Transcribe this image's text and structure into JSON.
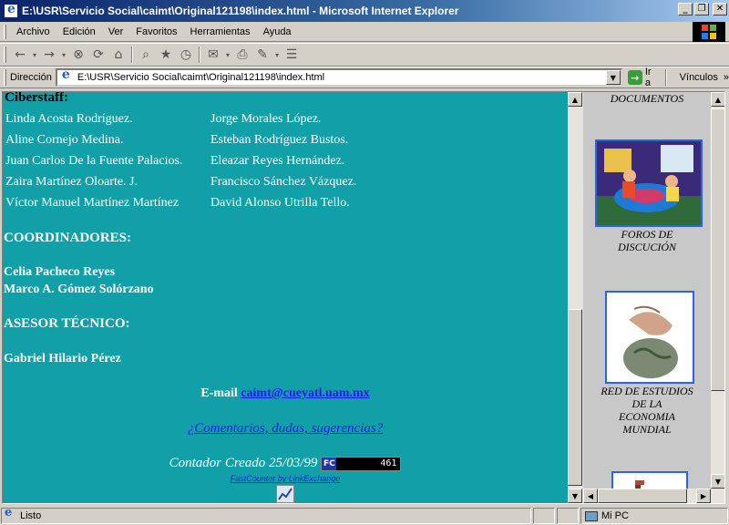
{
  "window": {
    "title": "E:\\USR\\Servicio Social\\caimt\\Original121198\\index.html - Microsoft Internet Explorer",
    "minimize": "_",
    "maximize": "❐",
    "close": "✕"
  },
  "menu": [
    "Archivo",
    "Edición",
    "Ver",
    "Favoritos",
    "Herramientas",
    "Ayuda"
  ],
  "addressbar": {
    "label": "Dirección",
    "url": "E:\\USR\\Servicio Social\\caimt\\Original121198\\index.html",
    "go_label": "Ir a",
    "links_label": "Vínculos"
  },
  "page": {
    "cyberstaff_heading": "Ciberstaff:",
    "names_col1": [
      "Linda Acosta Rodríguez.",
      "Aline Cornejo Medina.",
      "Juan Carlos De la Fuente Palacios.",
      "Zaira Martínez Oloarte. J.",
      "Víctor Manuel Martínez Martínez"
    ],
    "names_col2": [
      "Jorge Morales López.",
      "Esteban Rodríguez Bustos.",
      "Eleazar Reyes Hernández.",
      "Francisco Sánchez Vázquez.",
      "David Alonso Utrilla Tello."
    ],
    "coordinadores_heading": "COORDINADORES:",
    "coordinadores": [
      "Celia Pacheco Reyes",
      "Marco A. Gómez Solórzano"
    ],
    "asesor_heading": "ASESOR TÉCNICO:",
    "asesor": "Gabriel Hilario Pérez",
    "email_label": "E-mail",
    "email": "caimt@cueyatl.uam.mx",
    "comments_link": "¿Comentarios, dudas, sugerencias?",
    "counter_label": "Contador Creado 25/03/99",
    "counter_badge": "FC",
    "counter_value": "461",
    "fastcounter_link": "FastCounter by LinkExchange"
  },
  "sidebar": {
    "documentos": "DOCUMENTOS",
    "foros": [
      "FOROS DE",
      "DISCUCIÓN"
    ],
    "red": [
      "RED DE ESTUDIOS",
      "DE LA",
      "ECONOMIA",
      "MUNDIAL"
    ]
  },
  "status": {
    "text": "Listo",
    "zone": "Mi PC"
  }
}
